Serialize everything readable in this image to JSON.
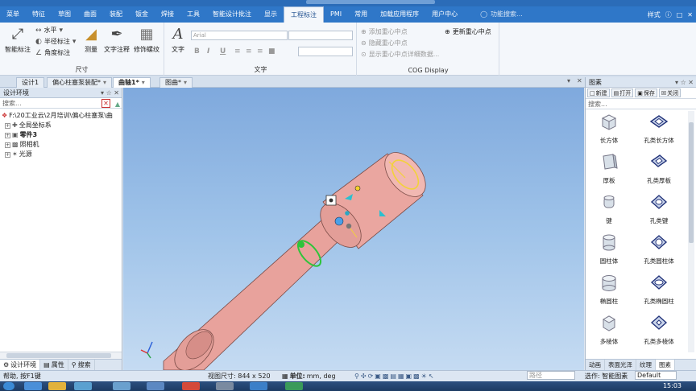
{
  "menubar": {
    "items": [
      "菜单",
      "特征",
      "草图",
      "曲面",
      "装配",
      "钣金",
      "焊接",
      "工具",
      "智能设计批注",
      "显示",
      "工程标注",
      "PMI",
      "常用",
      "加载应用程序",
      "用户中心"
    ],
    "active_index": 10,
    "search_placeholder": "功能搜索...",
    "style_label": "样式"
  },
  "ribbon": {
    "dimension_group": {
      "label": "尺寸",
      "smart_dim": "智能标注",
      "horizontal": "水平",
      "radius": "半径标注",
      "angle": "角度标注",
      "measure": "测量",
      "text_note": "文字注释",
      "thread": "修饰螺纹"
    },
    "text_group": {
      "label": "文字",
      "text_btn": "文字",
      "font_value": "Arial",
      "bold": "B",
      "italic": "I",
      "underline": "U"
    },
    "cog_group": {
      "label": "COG Display",
      "add_cog": "添加重心中点",
      "hide_cog": "隐藏重心中点",
      "show_cog_detail": "显示重心中点详细数据...",
      "update_cog": "更新重心中点"
    }
  },
  "doctabs": {
    "tabs": [
      "设计1",
      "偏心柱塞泵装配*",
      "曲轴1*",
      "图曲*"
    ],
    "active_index": 2
  },
  "leftpanel": {
    "title": "设计环境",
    "search_placeholder": "搜索...",
    "tree": [
      {
        "label": "F:\\20工业云\\2月培训\\偏心柱塞泵\\曲",
        "bold": false,
        "indent": 0
      },
      {
        "label": "全局坐标系",
        "bold": false,
        "indent": 1
      },
      {
        "label": "零件3",
        "bold": true,
        "indent": 1
      },
      {
        "label": "照相机",
        "bold": false,
        "indent": 1
      },
      {
        "label": "光源",
        "bold": false,
        "indent": 1
      }
    ],
    "tabs": [
      "设计环境",
      "属性",
      "搜索"
    ]
  },
  "rightpanel": {
    "title": "图素",
    "buttons": [
      "新建",
      "打开",
      "保存",
      "关闭"
    ],
    "search_placeholder": "搜索...",
    "shapes": [
      {
        "label": "长方体",
        "icon": "box-icon"
      },
      {
        "label": "孔类长方体",
        "icon": "hole-box-icon"
      },
      {
        "label": "厚板",
        "icon": "thick-plate-icon"
      },
      {
        "label": "孔类厚板",
        "icon": "hole-plate-icon"
      },
      {
        "label": "键",
        "icon": "key-icon"
      },
      {
        "label": "孔类键",
        "icon": "hole-key-icon"
      },
      {
        "label": "圆柱体",
        "icon": "cylinder-icon"
      },
      {
        "label": "孔类圆柱体",
        "icon": "hole-cylinder-icon"
      },
      {
        "label": "椭圆柱",
        "icon": "elliptic-cylinder-icon"
      },
      {
        "label": "孔类椭圆柱",
        "icon": "hole-elliptic-icon"
      },
      {
        "label": "多棱体",
        "icon": "prism-icon"
      },
      {
        "label": "孔类多棱体",
        "icon": "hole-prism-icon"
      }
    ],
    "tabs": [
      "动画",
      "表面光泽",
      "纹理",
      "图素"
    ]
  },
  "statusbar": {
    "help": "帮助, 按F1键",
    "view_size_label": "视图尺寸: 844 x 520",
    "unit_label": "单位:",
    "unit_value": "mm, deg",
    "mode_placeholder": "路径",
    "select_label": "选作: 智能图素",
    "default_label": "Default"
  },
  "taskbar": {
    "clock": "15:03"
  },
  "colors": {
    "menu_blue": "#2f77c8",
    "part_pink": "#e8a29c",
    "viewport_top": "#7fa9dd",
    "viewport_bottom": "#c5dbf2"
  }
}
